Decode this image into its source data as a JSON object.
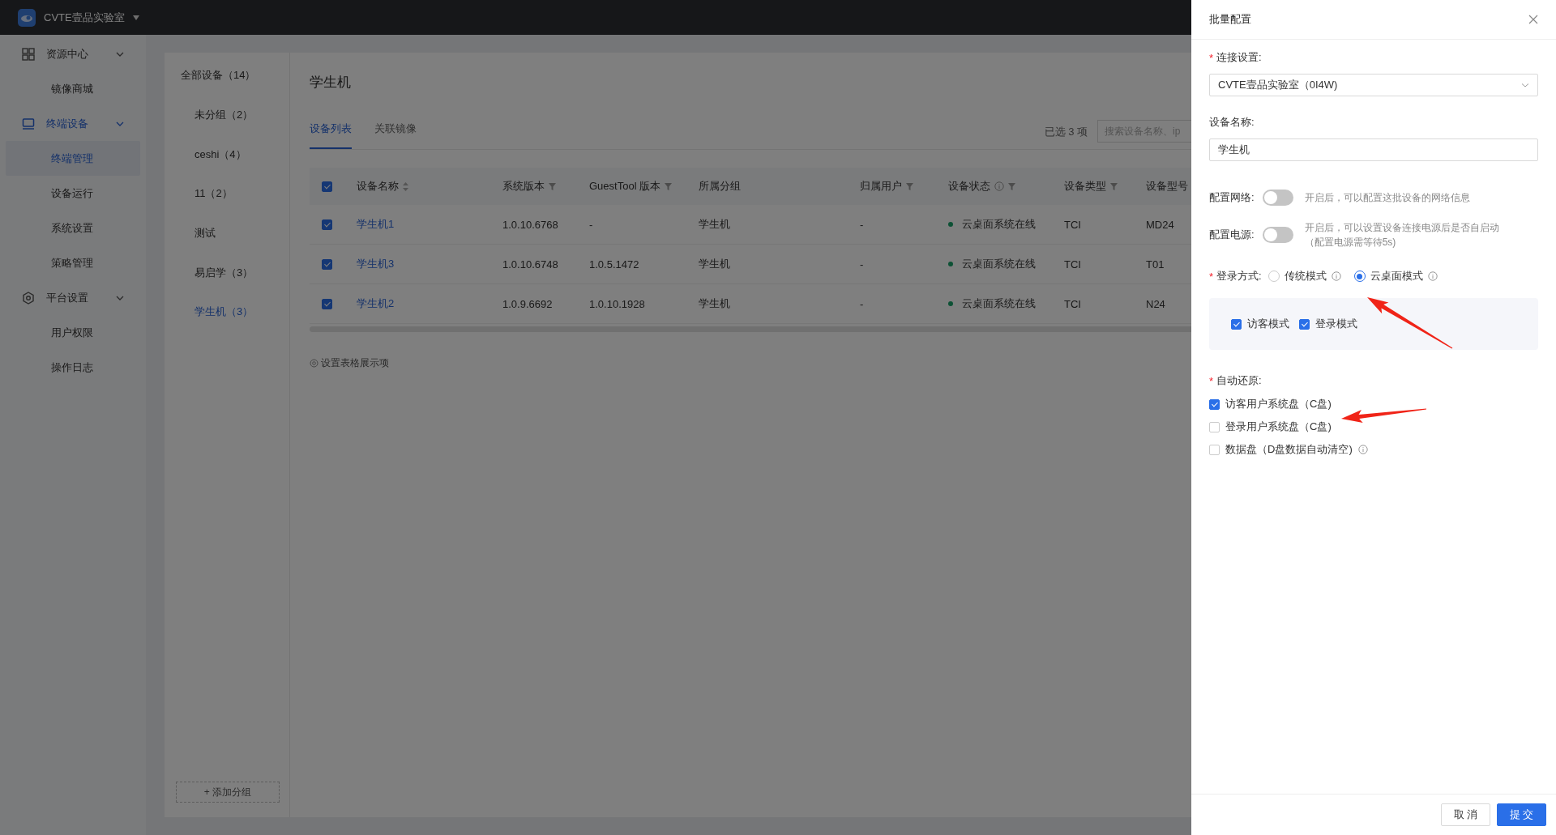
{
  "header": {
    "title": "CVTE壹品实验室"
  },
  "sidebar": {
    "items": [
      {
        "label": "资源中心",
        "selected": false,
        "expanded": true,
        "children": [
          {
            "label": "镜像商城",
            "selected": false
          }
        ]
      },
      {
        "label": "终端设备",
        "selected": true,
        "expanded": true,
        "children": [
          {
            "label": "终端管理",
            "selected": true
          },
          {
            "label": "设备运行",
            "selected": false
          },
          {
            "label": "系统设置",
            "selected": false
          },
          {
            "label": "策略管理",
            "selected": false
          }
        ]
      },
      {
        "label": "平台设置",
        "selected": false,
        "expanded": true,
        "children": [
          {
            "label": "用户权限",
            "selected": false
          },
          {
            "label": "操作日志",
            "selected": false
          }
        ]
      }
    ]
  },
  "groups": {
    "items": [
      {
        "label": "全部设备（14）",
        "selected": false,
        "children": [
          {
            "label": "未分组（2）",
            "selected": false
          },
          {
            "label": "ceshi（4）",
            "selected": false
          },
          {
            "label": "11（2）",
            "selected": false
          },
          {
            "label": "测试",
            "selected": false
          },
          {
            "label": "易启学（3）",
            "selected": false
          },
          {
            "label": "学生机（3）",
            "selected": true
          }
        ]
      }
    ],
    "add_button": "+ 添加分组"
  },
  "main": {
    "title": "学生机",
    "tabs": [
      {
        "label": "设备列表",
        "selected": true
      },
      {
        "label": "关联镜像",
        "selected": false
      }
    ],
    "selected_count": "已选 3 项",
    "search": {
      "placeholder": "搜索设备名称、ip"
    },
    "table": {
      "all_selected": true,
      "columns": [
        {
          "label": "设备名称",
          "kind": "sort"
        },
        {
          "label": "系统版本",
          "kind": "filter"
        },
        {
          "label": "GuestTool 版本",
          "kind": "filter"
        },
        {
          "label": "所属分组",
          "kind": "plain"
        },
        {
          "label": "归属用户",
          "kind": "filter"
        },
        {
          "label": "设备状态",
          "kind": "info-filter"
        },
        {
          "label": "设备类型",
          "kind": "filter"
        },
        {
          "label": "设备型号",
          "kind": "plain"
        }
      ],
      "rows": [
        {
          "selected": true,
          "cells": [
            "学生机1",
            "1.0.10.6768",
            "-",
            "学生机",
            "-",
            "云桌面系统在线",
            "TCI",
            "MD24"
          ]
        },
        {
          "selected": true,
          "cells": [
            "学生机3",
            "1.0.10.6748",
            "1.0.5.1472",
            "学生机",
            "-",
            "云桌面系统在线",
            "TCI",
            "T01"
          ]
        },
        {
          "selected": true,
          "cells": [
            "学生机2",
            "1.0.9.6692",
            "1.0.10.1928",
            "学生机",
            "-",
            "云桌面系统在线",
            "TCI",
            "N24"
          ]
        }
      ]
    },
    "settings_link": "设置表格展示项"
  },
  "drawer": {
    "title": "批量配置",
    "fields": [
      {
        "kind": "select",
        "required_mark": "*",
        "label": "连接设置:",
        "value": "CVTE壹品实验室（0I4W)"
      },
      {
        "kind": "input",
        "label": "设备名称:",
        "value": "学生机"
      },
      {
        "kind": "switch",
        "label": "配置网络:",
        "on": false,
        "hint": "开启后，可以配置这批设备的网络信息"
      },
      {
        "kind": "switch",
        "label": "配置电源:",
        "on": false,
        "hint": "开启后，可以设置设备连接电源后是否自启动（配置电源需等待5s)"
      },
      {
        "kind": "radio",
        "required_mark": "*",
        "label": "登录方式:",
        "options": [
          {
            "label": "传统模式",
            "selected": false
          },
          {
            "label": "云桌面模式",
            "selected": true
          }
        ],
        "sub_options": [
          {
            "label": "访客模式",
            "checked": true
          },
          {
            "label": "登录模式",
            "checked": true
          }
        ]
      },
      {
        "kind": "checklist",
        "required_mark": "*",
        "label": "自动还原:",
        "options": [
          {
            "label": "访客用户系统盘（C盘)",
            "checked": true,
            "info": false
          },
          {
            "label": "登录用户系统盘（C盘)",
            "checked": false,
            "info": false
          },
          {
            "label": "数据盘（D盘数据自动清空)",
            "checked": false,
            "info": true
          }
        ]
      }
    ],
    "buttons": [
      {
        "label": "取 消",
        "kind": "default"
      },
      {
        "label": "提 交",
        "kind": "primary"
      }
    ]
  }
}
